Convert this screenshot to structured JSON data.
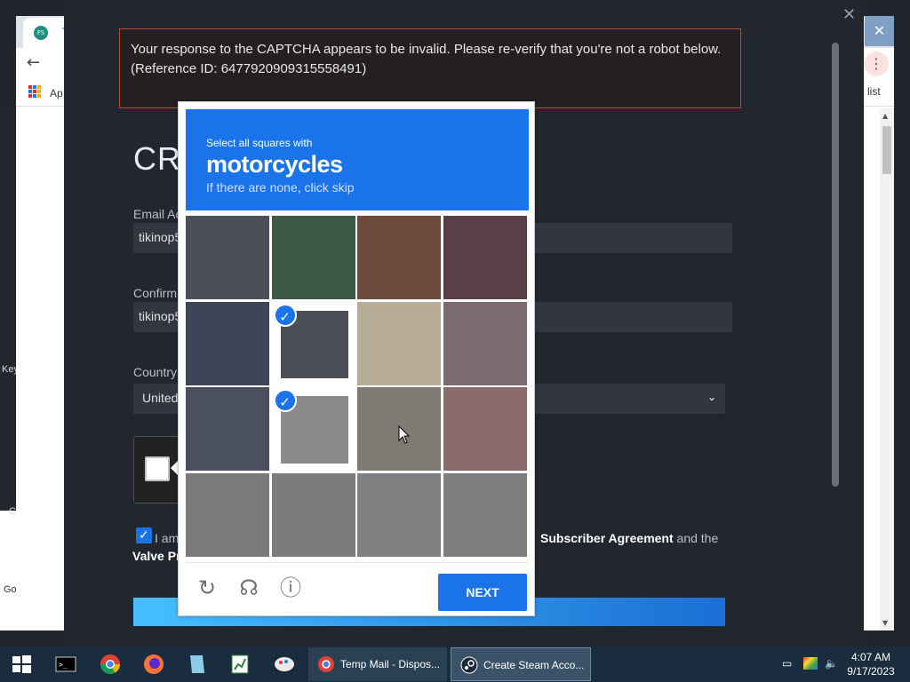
{
  "browser": {
    "tab_title": "Te",
    "apps_label": "Ap",
    "list_label": "list",
    "menu_glyph": "⋮",
    "back_glyph": "←",
    "close_glyph": "✕"
  },
  "side": {
    "key_label": "Key",
    "c_label": "C",
    "go_label": "Go"
  },
  "modal": {
    "close_glyph": "✕",
    "error": {
      "line1": "Your response to the CAPTCHA appears to be invalid. Please re-verify that you're not a robot below.",
      "line2": "(Reference ID: 6477920909315558491)"
    },
    "title": "CRI",
    "email_label": "Email Ac",
    "email_value": "tikinop5",
    "confirm_label": "Confirm",
    "confirm_value": "tikinop5",
    "country_label": "Country",
    "country_value": "United",
    "agree_start": "I am",
    "agree_end_link": "Subscriber Agreement",
    "agree_end_rest": " and the",
    "agree_second": "Valve Pr"
  },
  "captcha": {
    "instruction_small": "Select all squares with",
    "instruction_big": "motorcycles",
    "instruction_hint": "If there are none, click skip",
    "next_label": "NEXT",
    "tiles": [
      {
        "row": 0,
        "col": 0,
        "selected": false,
        "color": "#4a4f5a"
      },
      {
        "row": 0,
        "col": 1,
        "selected": false,
        "color": "#3f5a44"
      },
      {
        "row": 0,
        "col": 2,
        "selected": false,
        "color": "#6b4a3c"
      },
      {
        "row": 0,
        "col": 3,
        "selected": false,
        "color": "#5a3f4a"
      },
      {
        "row": 1,
        "col": 0,
        "selected": false,
        "color": "#3c4658"
      },
      {
        "row": 1,
        "col": 1,
        "selected": true,
        "color": "#4b4f55"
      },
      {
        "row": 1,
        "col": 2,
        "selected": false,
        "color": "#b8ad98"
      },
      {
        "row": 1,
        "col": 3,
        "selected": false,
        "color": "#7d6a70"
      },
      {
        "row": 2,
        "col": 0,
        "selected": false,
        "color": "#4a5060"
      },
      {
        "row": 2,
        "col": 1,
        "selected": true,
        "color": "#8b8b8b"
      },
      {
        "row": 2,
        "col": 2,
        "selected": false,
        "color": "#7f7a72"
      },
      {
        "row": 2,
        "col": 3,
        "selected": false,
        "color": "#8a6a6a"
      },
      {
        "row": 3,
        "col": 0,
        "selected": false,
        "color": "#7a7a7a"
      },
      {
        "row": 3,
        "col": 1,
        "selected": false,
        "color": "#7c7c7c"
      },
      {
        "row": 3,
        "col": 2,
        "selected": false,
        "color": "#808080"
      },
      {
        "row": 3,
        "col": 3,
        "selected": false,
        "color": "#7e7e7e"
      }
    ]
  },
  "taskbar": {
    "task1_label": "Temp Mail - Dispos...",
    "task2_label": "Create Steam Acco...",
    "time": "4:07 AM",
    "date": "9/17/2023"
  }
}
